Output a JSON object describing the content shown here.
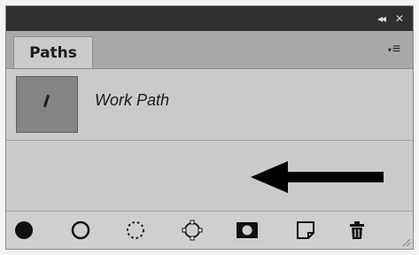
{
  "titlebar": {
    "collapse_glyph": "◂◂",
    "close_glyph": "✕"
  },
  "tabs": [
    {
      "label": "Paths",
      "active": true
    }
  ],
  "panel_menu": {
    "icon": "panel-menu-icon",
    "glyph": "≡",
    "triangle": "▾"
  },
  "paths": [
    {
      "name": "Work Path",
      "thumbnail_color": "#858585"
    }
  ],
  "annotation": {
    "icon": "arrow-left-icon",
    "color": "#000000"
  },
  "toolbar": {
    "tools": [
      {
        "icon": "fill-path-icon",
        "name": "Fill path with foreground color"
      },
      {
        "icon": "stroke-path-icon",
        "name": "Stroke path with brush"
      },
      {
        "icon": "load-selection-icon",
        "name": "Load path as a selection"
      },
      {
        "icon": "make-work-path-icon",
        "name": "Make work path from selection"
      },
      {
        "icon": "add-mask-icon",
        "name": "Add a mask"
      },
      {
        "icon": "new-path-icon",
        "name": "Create new path"
      },
      {
        "icon": "delete-path-icon",
        "name": "Delete current path"
      }
    ]
  },
  "colors": {
    "titlebar": "#2f2f2f",
    "tabrow": "#a9a9a9",
    "panel": "#cacaca"
  }
}
